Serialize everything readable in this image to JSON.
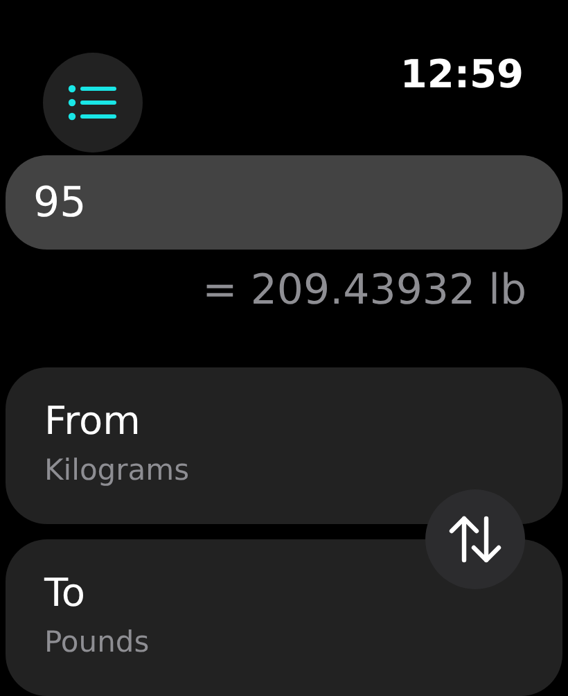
{
  "status_bar": {
    "time": "12:59"
  },
  "input": {
    "value": "95"
  },
  "result": "= 209.43932 lb",
  "units": [
    {
      "label": "From",
      "value": "Kilograms"
    },
    {
      "label": "To",
      "value": "Pounds"
    }
  ]
}
